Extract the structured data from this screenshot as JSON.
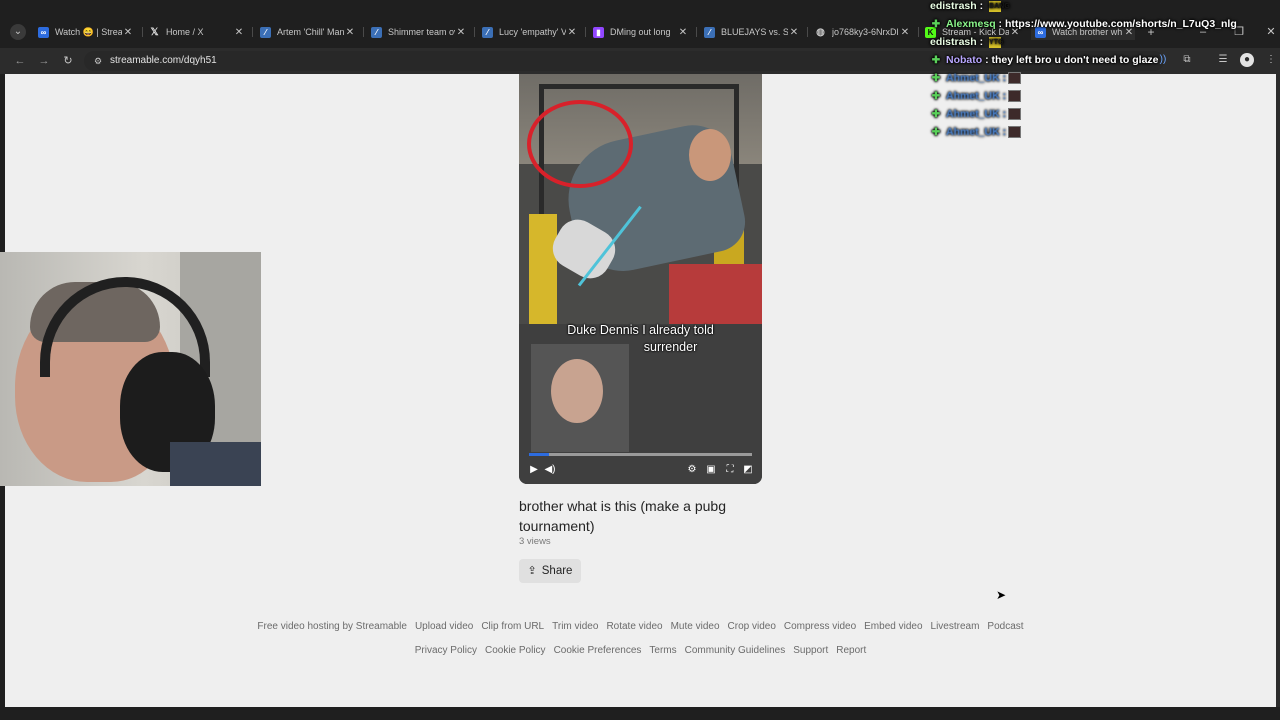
{
  "browser": {
    "tabs": [
      {
        "title": "Watch 😄 | Stream",
        "icon": "streamable-icon",
        "color": "#2d6cdf"
      },
      {
        "title": "Home / X",
        "icon": "x-icon",
        "color": "#1f1f1f"
      },
      {
        "title": "Artem 'Chill' Mani",
        "icon": "liquipedia-icon",
        "color": "#3b6fb6"
      },
      {
        "title": "Shimmer team ov",
        "icon": "liquipedia-icon",
        "color": "#3b6fb6"
      },
      {
        "title": "Lucy 'empathy' V",
        "icon": "liquipedia-icon",
        "color": "#3b6fb6"
      },
      {
        "title": "DMing out long",
        "icon": "twitch-icon",
        "color": "#9146ff"
      },
      {
        "title": "BLUEJAYS vs. Shin",
        "icon": "liquipedia-icon",
        "color": "#3b6fb6"
      },
      {
        "title": "jo768ky3-6NrxDl",
        "icon": "globe-icon",
        "color": "#6a6a6a"
      },
      {
        "title": "Stream - Kick Da",
        "icon": "kick-icon",
        "color": "#53fc18"
      },
      {
        "title": "Watch brother wh",
        "icon": "streamable-icon",
        "color": "#2d6cdf"
      }
    ],
    "url": "streamable.com/dqyh51"
  },
  "video": {
    "caption_line1": "Duke Dennis I already told",
    "caption_line2": "surrender",
    "progress": 0.09
  },
  "page": {
    "title": "brother what is this (make a pubg tournament)",
    "views": "3 views",
    "share_label": "Share"
  },
  "footer": {
    "row1": [
      "Free video hosting by Streamable",
      "Upload video",
      "Clip from URL",
      "Trim video",
      "Rotate video",
      "Mute video",
      "Crop video",
      "Compress video",
      "Embed video",
      "Livestream",
      "Podcast"
    ],
    "row2": [
      "Privacy Policy",
      "Cookie Policy",
      "Cookie Preferences",
      "Terms",
      "Community Guidelines",
      "Support",
      "Report"
    ]
  },
  "chat": [
    {
      "name": "edistrash",
      "sep": " :",
      "msg": "",
      "badge": "BANG"
    },
    {
      "name": "Alexmesq",
      "sep": " :",
      "msg": " https://www.youtube.com/shorts/n_L7uQ3_nlg",
      "badge": ""
    },
    {
      "name": "edistrash",
      "sep": " :",
      "msg": "",
      "badge": "YTG"
    },
    {
      "name": "Nobato",
      "sep": " :",
      "msg": " they left bro u don't need to glaze",
      "badge": ""
    },
    {
      "name": "Ahmet_UK",
      "sep": " :",
      "msg": "",
      "badge": ""
    },
    {
      "name": "Ahmet_UK",
      "sep": " :",
      "msg": "",
      "badge": ""
    },
    {
      "name": "Ahmet_UK",
      "sep": " :",
      "msg": "",
      "badge": ""
    },
    {
      "name": "Ahmet_UK",
      "sep": " :",
      "msg": "",
      "badge": ""
    }
  ]
}
